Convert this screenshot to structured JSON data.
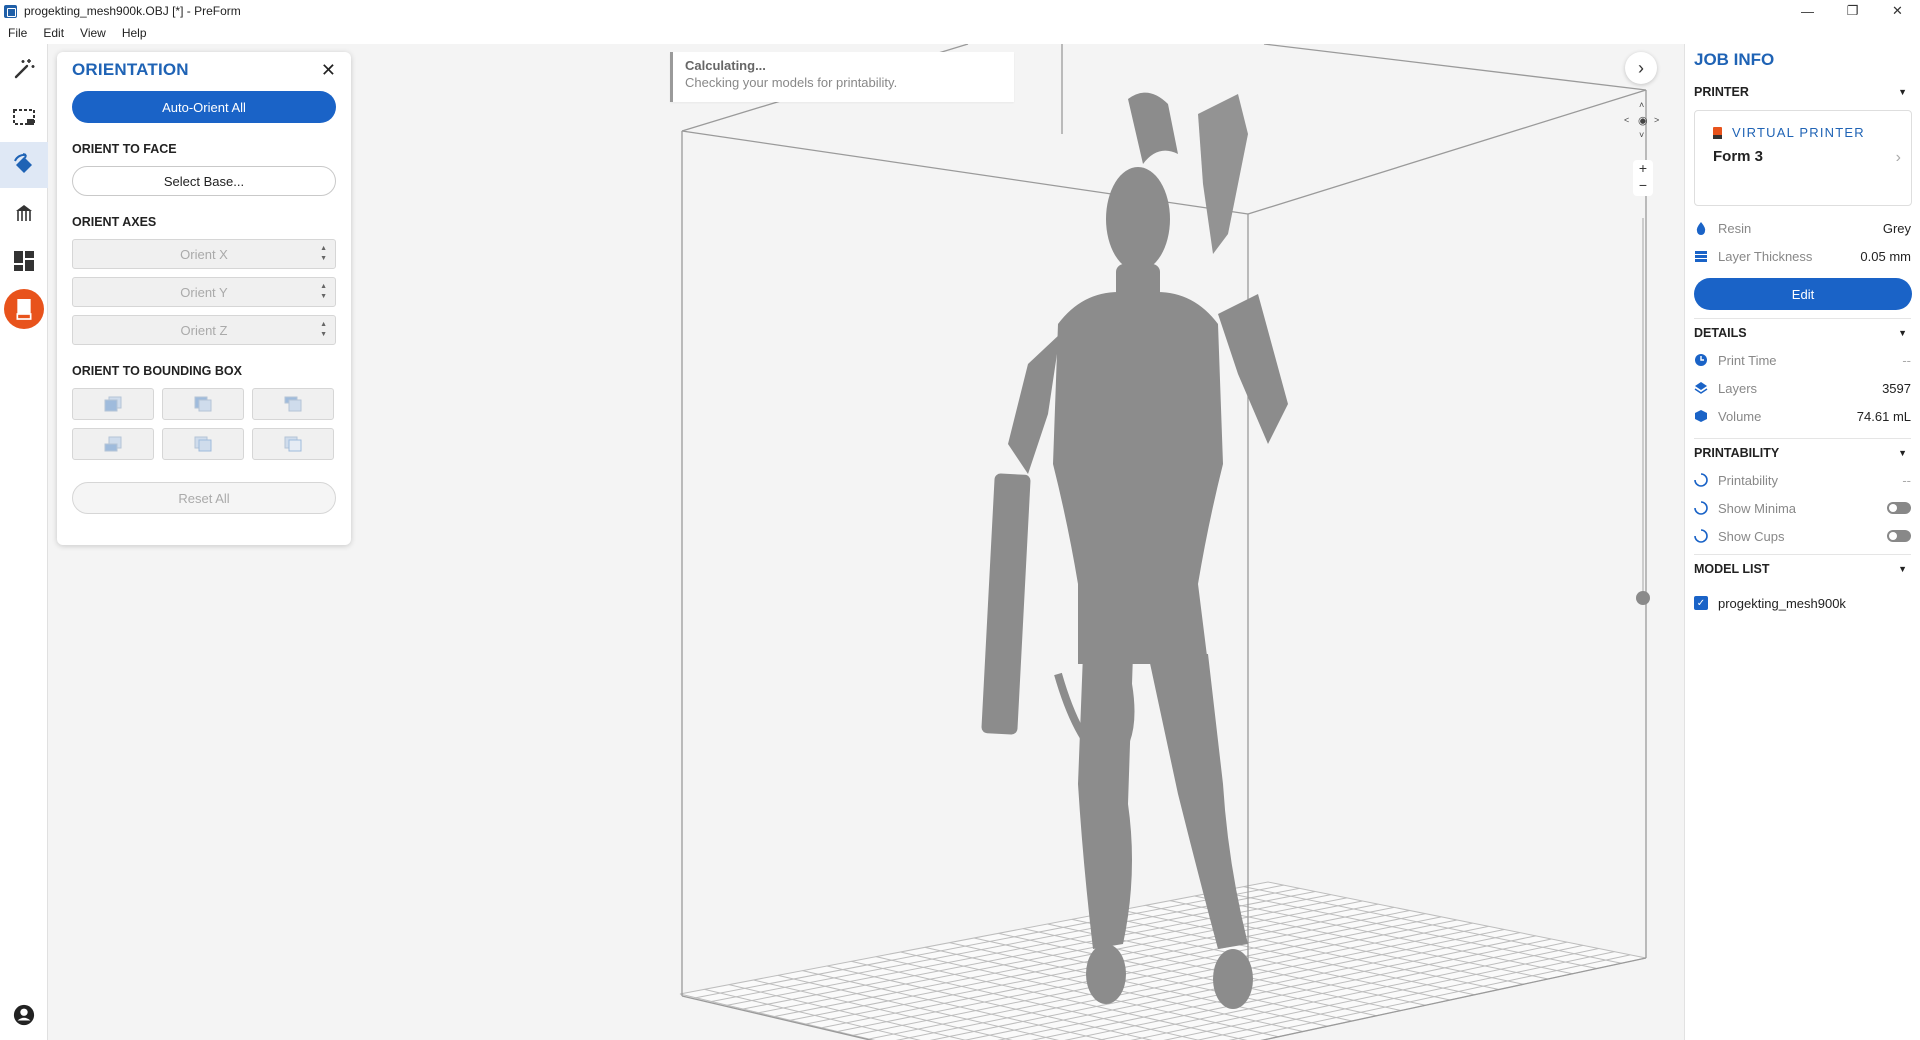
{
  "window": {
    "title": "progekting_mesh900k.OBJ [*] - PreForm"
  },
  "menu": [
    "File",
    "Edit",
    "View",
    "Help"
  ],
  "toolbar": {
    "tools": [
      {
        "name": "magic-wand-icon"
      },
      {
        "name": "select-icon"
      },
      {
        "name": "orientation-icon",
        "active": true
      },
      {
        "name": "supports-icon"
      },
      {
        "name": "layout-icon"
      },
      {
        "name": "print-icon"
      }
    ],
    "account_icon": "account-icon"
  },
  "orientation": {
    "title": "ORIENTATION",
    "auto_orient_label": "Auto-Orient All",
    "orient_face_title": "ORIENT TO FACE",
    "select_base_label": "Select Base...",
    "axes_title": "ORIENT AXES",
    "axes": [
      "Orient X",
      "Orient Y",
      "Orient Z"
    ],
    "bbox_title": "ORIENT TO BOUNDING BOX",
    "reset_label": "Reset All"
  },
  "status": {
    "title": "Calculating...",
    "message": "Checking your models for printability."
  },
  "job_info": {
    "title": "JOB INFO",
    "printer_section": "PRINTER",
    "printer_type": "VIRTUAL PRINTER",
    "printer_model": "Form 3",
    "resin_label": "Resin",
    "resin_value": "Grey",
    "thickness_label": "Layer Thickness",
    "thickness_value": "0.05 mm",
    "edit_label": "Edit",
    "details_section": "DETAILS",
    "print_time_label": "Print Time",
    "print_time_value": "--",
    "layers_label": "Layers",
    "layers_value": "3597",
    "volume_label": "Volume",
    "volume_value": "74.61 mL",
    "printability_section": "PRINTABILITY",
    "printability_label": "Printability",
    "printability_value": "--",
    "show_minima_label": "Show Minima",
    "show_cups_label": "Show Cups",
    "model_list_section": "MODEL LIST",
    "model_name": "progekting_mesh900k"
  },
  "colors": {
    "accent": "#1a63c7",
    "heading": "#1f63b5",
    "print_button": "#e8531c",
    "model_grey": "#8c8c8c"
  }
}
